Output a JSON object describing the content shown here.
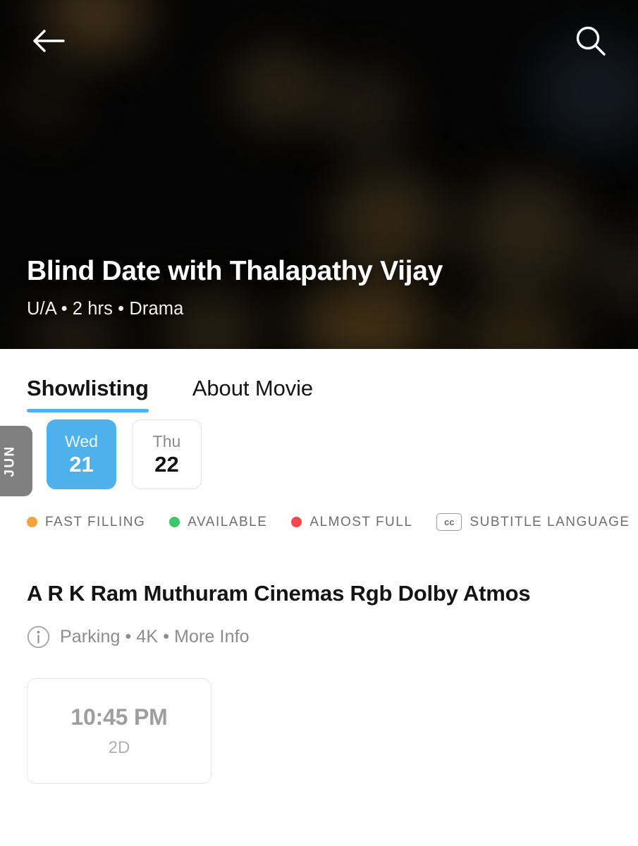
{
  "header": {
    "back_icon": "back-arrow-icon",
    "search_icon": "search-icon"
  },
  "hero": {
    "title": "Blind Date with Thalapathy Vijay",
    "meta": "U/A • 2 hrs • Drama",
    "certificate": "U/A",
    "duration": "2 hrs",
    "genre": "Drama"
  },
  "tabs": [
    {
      "label": "Showlisting",
      "active": true
    },
    {
      "label": "About Movie",
      "active": false
    }
  ],
  "dates": {
    "month": "JUN",
    "items": [
      {
        "day": "Wed",
        "num": "21",
        "selected": true
      },
      {
        "day": "Thu",
        "num": "22",
        "selected": false
      }
    ]
  },
  "legend": [
    {
      "label": "FAST FILLING",
      "color": "#f0a53a",
      "icon": "status-dot-icon"
    },
    {
      "label": "AVAILABLE",
      "color": "#3cc86a",
      "icon": "status-dot-icon"
    },
    {
      "label": "ALMOST FULL",
      "color": "#f0484e",
      "icon": "status-dot-icon"
    },
    {
      "label": "SUBTITLE LANGUAGE",
      "color": "#6e6e6e",
      "icon": "cc-icon",
      "badge": "cc"
    }
  ],
  "venue": {
    "name": "A R K Ram Muthuram Cinemas Rgb Dolby Atmos",
    "info": "Parking • 4K • More Info",
    "info_icon": "info-circle-icon"
  },
  "showtimes": [
    {
      "time": "10:45 PM",
      "format": "2D"
    }
  ],
  "colors": {
    "accent": "#4eb1ec",
    "month_tab": "#808080",
    "text_primary": "#141414",
    "text_muted": "#8c8c8c",
    "hero_bg": "#050505"
  }
}
